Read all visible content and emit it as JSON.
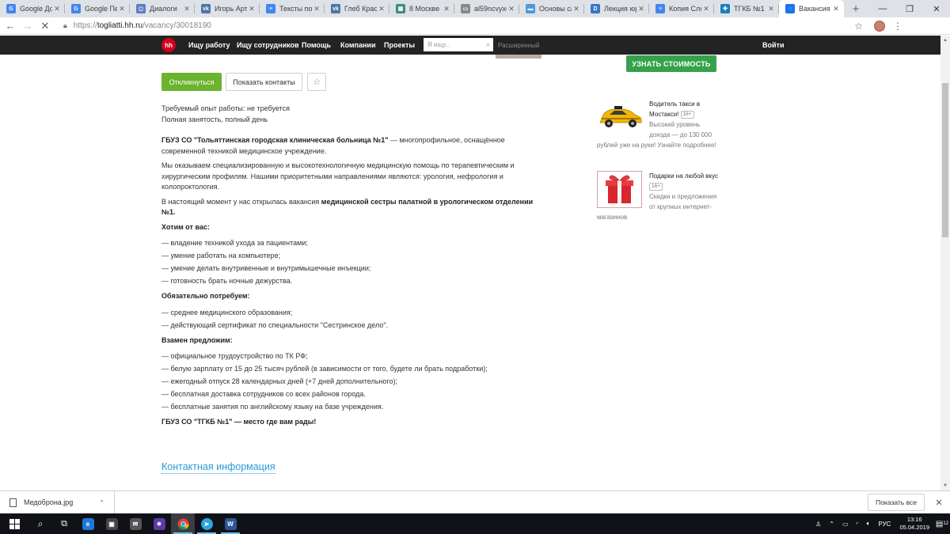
{
  "browser": {
    "tabs": [
      {
        "title": "Google Док",
        "favicon": "G",
        "color": "#4285f4"
      },
      {
        "title": "Google Пер",
        "favicon": "G",
        "color": "#4285f4"
      },
      {
        "title": "Диалоги",
        "favicon": "◻",
        "color": "#5b7fc4"
      },
      {
        "title": "Игорь Арте",
        "favicon": "vk",
        "color": "#4a76a8"
      },
      {
        "title": "Тексты под",
        "favicon": "≡",
        "color": "#4285f4"
      },
      {
        "title": "Глеб Красн",
        "favicon": "vk",
        "color": "#4a76a8"
      },
      {
        "title": "8 Москве з",
        "favicon": "▦",
        "color": "#3a8f7d"
      },
      {
        "title": "al59ncvyxc",
        "favicon": "▭",
        "color": "#888888"
      },
      {
        "title": "Основы са",
        "favicon": "▬",
        "color": "#4a9bd8"
      },
      {
        "title": "Лекция юр",
        "favicon": "D",
        "color": "#3577c9"
      },
      {
        "title": "Копия Слое",
        "favicon": "≡",
        "color": "#4285f4"
      },
      {
        "title": "ТГКБ №1 -",
        "favicon": "✚",
        "color": "#1a7fbc"
      },
      {
        "title": "Вакансия М",
        "favicon": "◌",
        "color": "#1a73e8"
      }
    ],
    "url_host": "togliatti.hh.ru",
    "url_path": "/vacancy/30018190",
    "url_prefix": "https://"
  },
  "hh": {
    "logo": "hh",
    "nav": [
      "Ищу работу",
      "Ищу сотрудников",
      "Помощь",
      "Компании",
      "Проекты"
    ],
    "search_placeholder": "Я ищу...",
    "advanced": "Расширенный",
    "login": "Войти"
  },
  "actions": {
    "respond": "Откликнуться",
    "contacts": "Показать контакты",
    "price": "УЗНАТЬ СТОИМОСТЬ"
  },
  "vacancy": {
    "experience": "Требуемый опыт работы: не требуется",
    "employment": "Полная занятость, полный день",
    "org_bold": "ГБУЗ СО \"Тольяттинская городская клиническая больница №1\"",
    "org_rest": " — многопрофильное, оснащённое современной техникой медицинское учреждение.",
    "para2": "Мы оказываем специализированную и высокотехнологичную медицинскую помощь по терапевтическим и хирургическим профилям. Нашими приоритетными направлениями являются: урология, нефрология и колопроктология.",
    "para3_start": "В настоящий момент у нас открылась вакансия ",
    "para3_bold": "медицинской сестры палатной в урологическом отделении №1.",
    "want_title": "Хотим от вас:",
    "want": [
      "— владение техникой ухода за пациентами;",
      "— умение работать на компьютере;",
      "— умение делать внутривенные и внутримышечные инъекции;",
      "— готовность брать ночные дежурства."
    ],
    "require_title": "Обязательно потребуем:",
    "require": [
      "— среднее медицинского образования;",
      "— действующий сертификат по специальности \"Сестринское дело\"."
    ],
    "offer_title": "Взамен предложим:",
    "offer": [
      "— официальное трудоустройство по ТК РФ;",
      "— белую зарплату от 15 до 25 тысяч рублей (в зависимости от того, будете ли брать подработки);",
      "— ежегодный отпуск 28 календарных дней (+7 дней дополнительного);",
      "— бесплатная доставка сотрудников со всех районов города.",
      "— бесплатные занятия по английскому языку на базе учреждения."
    ],
    "closing": "ГБУЗ СО \"ТГКБ №1\" — место где вам рады!",
    "contact_title": "Контактная информация"
  },
  "ads": [
    {
      "line1": "Водитель такси в",
      "line2": "Мостакси!",
      "age": "16+",
      "desc": [
        "Высокий уровень",
        "дохода — до 130 000"
      ],
      "tail": "рублей уже на руки! Узнайте подробнее!"
    },
    {
      "line1": "Подарки на любой вкус",
      "age": "16+",
      "desc": [
        "Скидки и предложения",
        "от крупных интернет-"
      ],
      "tail": "магазинов"
    }
  ],
  "downloads": {
    "file": "Медоброна.jpg",
    "show_all": "Показать все"
  },
  "taskbar": {
    "lang": "РУС",
    "time": "13:16",
    "date": "05.04.2019",
    "notif_count": "12"
  }
}
